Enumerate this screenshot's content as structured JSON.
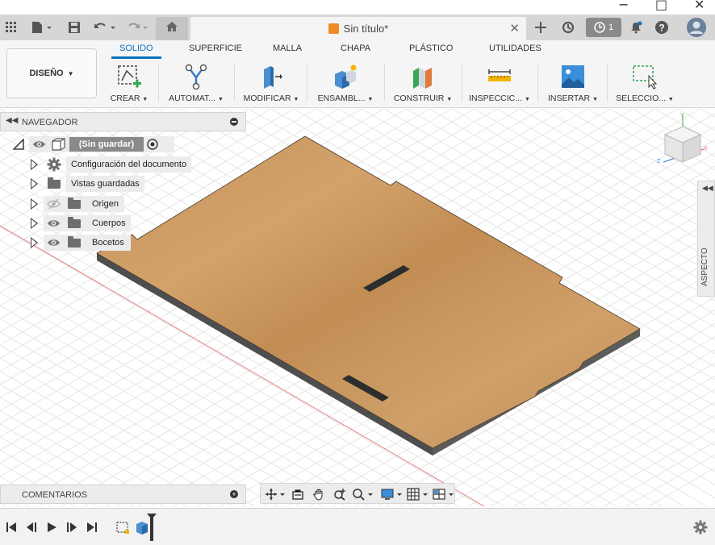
{
  "window": {
    "controls": [
      "−",
      "□",
      "✕"
    ]
  },
  "titlebar": {
    "document_title": "Sin título*",
    "close_symbol": "✕",
    "jobs_count": "1",
    "icons": [
      "grid-icon",
      "file-icon",
      "save-icon",
      "undo-icon",
      "redo-icon",
      "home-icon",
      "new-tab-icon",
      "extensions-icon",
      "jobs-icon",
      "notifications-icon",
      "help-icon",
      "user-avatar"
    ]
  },
  "ribbon": {
    "workspace": "DISEÑO",
    "tabs": [
      {
        "label": "SOLIDO",
        "active": true
      },
      {
        "label": "SUPERFICIE",
        "active": false
      },
      {
        "label": "MALLA",
        "active": false
      },
      {
        "label": "CHAPA",
        "active": false
      },
      {
        "label": "PLÁSTICO",
        "active": false
      },
      {
        "label": "UTILIDADES",
        "active": false
      }
    ],
    "groups": [
      {
        "label": "CREAR",
        "icon": "create-sketch-icon"
      },
      {
        "label": "AUTOMAT...",
        "icon": "automate-icon"
      },
      {
        "label": "MODIFICAR",
        "icon": "modify-icon"
      },
      {
        "label": "ENSAMBL...",
        "icon": "assemble-icon"
      },
      {
        "label": "CONSTRUIR",
        "icon": "construct-icon"
      },
      {
        "label": "INSPECCIC...",
        "icon": "inspect-icon"
      },
      {
        "label": "INSERTAR",
        "icon": "insert-icon"
      },
      {
        "label": "SELECCIO...",
        "icon": "select-icon"
      }
    ],
    "accent_color": "#0a73c2"
  },
  "navigator": {
    "title": "NAVEGADOR",
    "root": "(Sin guardar)",
    "items": [
      {
        "label": "Configuración del documento",
        "icon": "gear-icon",
        "visible_toggle": false
      },
      {
        "label": "Vistas guardadas",
        "icon": "folder-icon",
        "visible_toggle": false
      },
      {
        "label": "Origen",
        "icon": "folder-icon",
        "visible_toggle": true,
        "hidden": true
      },
      {
        "label": "Cuerpos",
        "icon": "folder-icon",
        "visible_toggle": true,
        "hidden": false
      },
      {
        "label": "Bocetos",
        "icon": "folder-icon",
        "visible_toggle": true,
        "hidden": false
      }
    ]
  },
  "viewcube": {
    "axes": [
      "Y",
      "Z",
      "X"
    ]
  },
  "aspect_panel": {
    "label": "ASPECTO"
  },
  "comments": {
    "title": "COMENTARIOS"
  },
  "nav_toolbar": {
    "icons": [
      "orbit-icon",
      "look-at-icon",
      "pan-icon",
      "zoom-icon",
      "fit-icon",
      "display-settings-icon",
      "grid-settings-icon",
      "viewports-icon"
    ]
  },
  "timeline": {
    "icons": [
      "first-icon",
      "previous-icon",
      "play-icon",
      "next-icon",
      "last-icon",
      "sketch-feature-icon",
      "extrude-feature-icon"
    ]
  },
  "colors": {
    "wood": "#c9965a",
    "wood_edge": "#5a5a5a",
    "grid": "#e4e4e4",
    "red_axis": "#e07070"
  }
}
